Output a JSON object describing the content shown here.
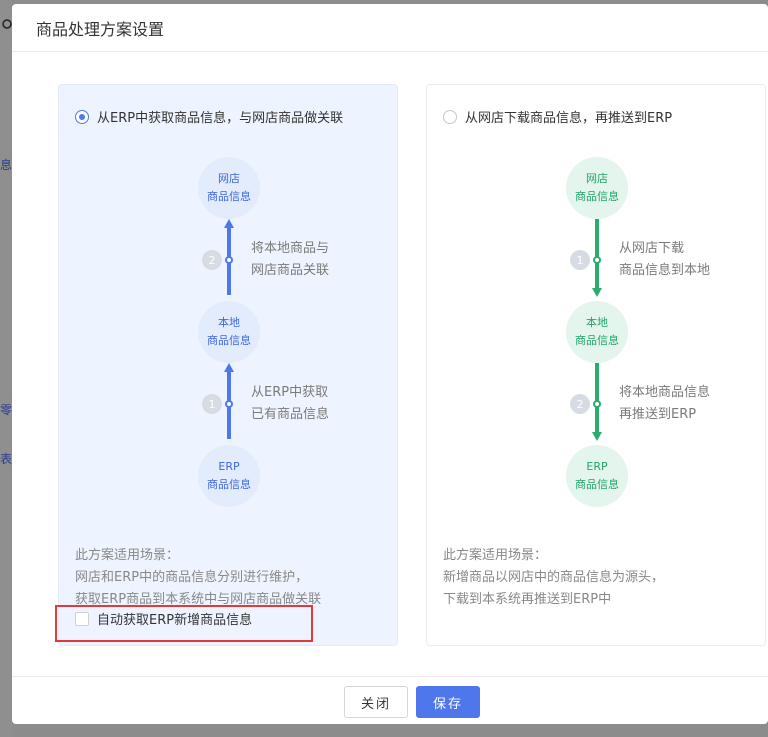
{
  "background": {
    "fragments": [
      "息...",
      "零...",
      "表..."
    ]
  },
  "dialog": {
    "title": "商品处理方案设置"
  },
  "left_option": {
    "label": "从ERP中获取商品信息，与网店商品做关联",
    "selected": true,
    "nodes": {
      "top": [
        "网店",
        "商品信息"
      ],
      "middle": [
        "本地",
        "商品信息"
      ],
      "bottom": [
        "ERP",
        "商品信息"
      ]
    },
    "steps": [
      {
        "num": "2",
        "lines": [
          "将本地商品与",
          "网店商品关联"
        ]
      },
      {
        "num": "1",
        "lines": [
          "从ERP中获取",
          "已有商品信息"
        ]
      }
    ],
    "scenario": [
      "此方案适用场景：",
      "网店和ERP中的商品信息分别进行维护，",
      "获取ERP商品到本系统中与网店商品做关联"
    ],
    "auto_fetch_label": "自动获取ERP新增商品信息",
    "auto_fetch_checked": false
  },
  "right_option": {
    "label": "从网店下载商品信息，再推送到ERP",
    "selected": false,
    "nodes": {
      "top": [
        "网店",
        "商品信息"
      ],
      "middle": [
        "本地",
        "商品信息"
      ],
      "bottom": [
        "ERP",
        "商品信息"
      ]
    },
    "steps": [
      {
        "num": "1",
        "lines": [
          "从网店下载",
          "商品信息到本地"
        ]
      },
      {
        "num": "2",
        "lines": [
          "将本地商品信息",
          "再推送到ERP"
        ]
      }
    ],
    "scenario": [
      "此方案适用场景：",
      "新增商品以网店中的商品信息为源头，",
      "下载到本系统再推送到ERP中"
    ]
  },
  "footer": {
    "close_label": "关闭",
    "save_label": "保存"
  },
  "colors": {
    "accent_blue": "#4e77ec",
    "accent_green": "#2aab6f",
    "highlight_red": "#e03a3a"
  }
}
